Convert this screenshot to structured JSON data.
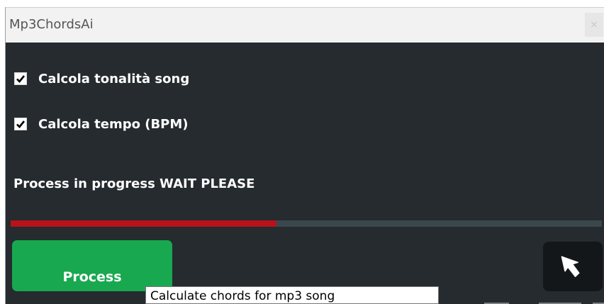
{
  "window": {
    "title": "Mp3ChordsAi",
    "close_glyph": "×"
  },
  "options": [
    {
      "label": "Calcola tonalità song",
      "checked": true
    },
    {
      "label": "Calcola tempo (BPM)",
      "checked": true
    }
  ],
  "status": {
    "text": "Process in progress WAIT PLEASE"
  },
  "progress": {
    "fraction": 0.45,
    "fill_color": "#b8121a",
    "track_color": "#3a474d"
  },
  "actions": {
    "process_label": "Process",
    "process_color": "#18a84f",
    "back_icon": "cursor-arrow-back-icon"
  },
  "tooltip": {
    "text": "Calculate chords for mp3 song"
  },
  "colors": {
    "window_bg": "#252b2e",
    "titlebar_bg": "#f2f2f2"
  }
}
